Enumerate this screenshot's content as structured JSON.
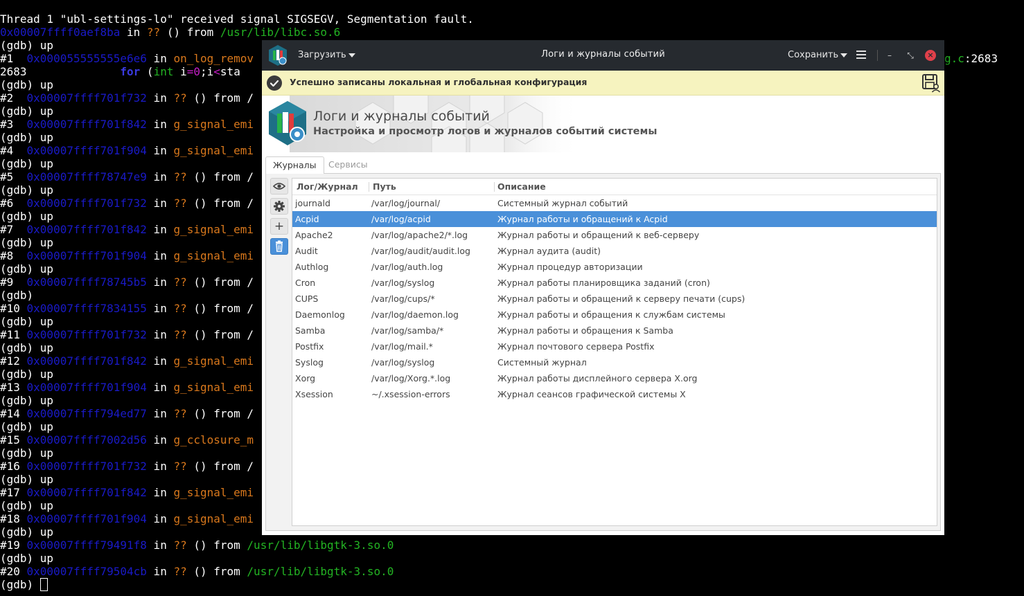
{
  "terminal": {
    "lines": [
      [
        {
          "t": "Thread 1 \"ubl-settings-lo\" received signal SIGSEGV, Segmentation fault."
        }
      ],
      [
        {
          "t": "0x00007ffff0aef8ba",
          "c": "addr"
        },
        {
          "t": " in "
        },
        {
          "t": "??",
          "c": "q"
        },
        {
          "t": " () from "
        },
        {
          "t": "/usr/lib/libc.so.6",
          "c": "path"
        }
      ],
      [
        {
          "t": "(gdb) up"
        }
      ],
      [
        {
          "t": "#1  "
        },
        {
          "t": "0x000055555555e6e6",
          "c": "addr"
        },
        {
          "t": " in "
        },
        {
          "t": "on_log_remov",
          "c": "fn"
        }
      ],
      [
        {
          "t": "2683              "
        },
        {
          "t": "for",
          "c": "kw"
        },
        {
          "t": " ("
        },
        {
          "t": "int",
          "c": "type"
        },
        {
          "t": " i"
        },
        {
          "t": "=",
          "c": "op"
        },
        {
          "t": "0",
          "c": "num"
        },
        {
          "t": ";i"
        },
        {
          "t": "<",
          "c": "op"
        },
        {
          "t": "sta"
        }
      ],
      [
        {
          "t": "(gdb) up"
        }
      ],
      [
        {
          "t": "#2  "
        },
        {
          "t": "0x00007ffff701f732",
          "c": "addr"
        },
        {
          "t": " in "
        },
        {
          "t": "??",
          "c": "q"
        },
        {
          "t": " () from /"
        }
      ],
      [
        {
          "t": "(gdb) up"
        }
      ],
      [
        {
          "t": "#3  "
        },
        {
          "t": "0x00007ffff701f842",
          "c": "addr"
        },
        {
          "t": " in "
        },
        {
          "t": "g_signal_emi",
          "c": "fn"
        }
      ],
      [
        {
          "t": "(gdb) up"
        }
      ],
      [
        {
          "t": "#4  "
        },
        {
          "t": "0x00007ffff701f904",
          "c": "addr"
        },
        {
          "t": " in "
        },
        {
          "t": "g_signal_emi",
          "c": "fn"
        }
      ],
      [
        {
          "t": "(gdb) up"
        }
      ],
      [
        {
          "t": "#5  "
        },
        {
          "t": "0x00007ffff78747e9",
          "c": "addr"
        },
        {
          "t": " in "
        },
        {
          "t": "??",
          "c": "q"
        },
        {
          "t": " () from /"
        }
      ],
      [
        {
          "t": "(gdb) up"
        }
      ],
      [
        {
          "t": "#6  "
        },
        {
          "t": "0x00007ffff701f732",
          "c": "addr"
        },
        {
          "t": " in "
        },
        {
          "t": "??",
          "c": "q"
        },
        {
          "t": " () from /"
        }
      ],
      [
        {
          "t": "(gdb) up"
        }
      ],
      [
        {
          "t": "#7  "
        },
        {
          "t": "0x00007ffff701f842",
          "c": "addr"
        },
        {
          "t": " in "
        },
        {
          "t": "g_signal_emi",
          "c": "fn"
        }
      ],
      [
        {
          "t": "(gdb) up"
        }
      ],
      [
        {
          "t": "#8  "
        },
        {
          "t": "0x00007ffff701f904",
          "c": "addr"
        },
        {
          "t": " in "
        },
        {
          "t": "g_signal_emi",
          "c": "fn"
        }
      ],
      [
        {
          "t": "(gdb) up"
        }
      ],
      [
        {
          "t": "#9  "
        },
        {
          "t": "0x00007ffff78745b5",
          "c": "addr"
        },
        {
          "t": " in "
        },
        {
          "t": "??",
          "c": "q"
        },
        {
          "t": " () from /"
        }
      ],
      [
        {
          "t": "(gdb)"
        }
      ],
      [
        {
          "t": "#10 "
        },
        {
          "t": "0x00007ffff7834155",
          "c": "addr"
        },
        {
          "t": " in "
        },
        {
          "t": "??",
          "c": "q"
        },
        {
          "t": " () from /"
        }
      ],
      [
        {
          "t": "(gdb) up"
        }
      ],
      [
        {
          "t": "#11 "
        },
        {
          "t": "0x00007ffff701f732",
          "c": "addr"
        },
        {
          "t": " in "
        },
        {
          "t": "??",
          "c": "q"
        },
        {
          "t": " () from /"
        }
      ],
      [
        {
          "t": "(gdb) up"
        }
      ],
      [
        {
          "t": "#12 "
        },
        {
          "t": "0x00007ffff701f842",
          "c": "addr"
        },
        {
          "t": " in "
        },
        {
          "t": "g_signal_emi",
          "c": "fn"
        }
      ],
      [
        {
          "t": "(gdb) up"
        }
      ],
      [
        {
          "t": "#13 "
        },
        {
          "t": "0x00007ffff701f904",
          "c": "addr"
        },
        {
          "t": " in "
        },
        {
          "t": "g_signal_emi",
          "c": "fn"
        }
      ],
      [
        {
          "t": "(gdb) up"
        }
      ],
      [
        {
          "t": "#14 "
        },
        {
          "t": "0x00007ffff794ed77",
          "c": "addr"
        },
        {
          "t": " in "
        },
        {
          "t": "??",
          "c": "q"
        },
        {
          "t": " () from /"
        }
      ],
      [
        {
          "t": "(gdb) up"
        }
      ],
      [
        {
          "t": "#15 "
        },
        {
          "t": "0x00007ffff7002d56",
          "c": "addr"
        },
        {
          "t": " in "
        },
        {
          "t": "g_cclosure_m",
          "c": "fn"
        }
      ],
      [
        {
          "t": "(gdb) up"
        }
      ],
      [
        {
          "t": "#16 "
        },
        {
          "t": "0x00007ffff701f732",
          "c": "addr"
        },
        {
          "t": " in "
        },
        {
          "t": "??",
          "c": "q"
        },
        {
          "t": " () from /"
        }
      ],
      [
        {
          "t": "(gdb) up"
        }
      ],
      [
        {
          "t": "#17 "
        },
        {
          "t": "0x00007ffff701f842",
          "c": "addr"
        },
        {
          "t": " in "
        },
        {
          "t": "g_signal_emi",
          "c": "fn"
        }
      ],
      [
        {
          "t": "(gdb) up"
        }
      ],
      [
        {
          "t": "#18 "
        },
        {
          "t": "0x00007ffff701f904",
          "c": "addr"
        },
        {
          "t": " in "
        },
        {
          "t": "g_signal_emi",
          "c": "fn"
        }
      ],
      [
        {
          "t": "(gdb) up"
        }
      ],
      [
        {
          "t": "#19 "
        },
        {
          "t": "0x00007ffff79491f8",
          "c": "addr"
        },
        {
          "t": " in "
        },
        {
          "t": "??",
          "c": "q"
        },
        {
          "t": " () from "
        },
        {
          "t": "/usr/lib/libgtk-3.so.0",
          "c": "path"
        }
      ],
      [
        {
          "t": "(gdb) up"
        }
      ],
      [
        {
          "t": "#20 "
        },
        {
          "t": "0x00007ffff79504cb",
          "c": "addr"
        },
        {
          "t": " in "
        },
        {
          "t": "??",
          "c": "q"
        },
        {
          "t": " () from "
        },
        {
          "t": "/usr/lib/libgtk-3.so.0",
          "c": "path"
        }
      ],
      [
        {
          "t": "(gdb) "
        }
      ]
    ],
    "right_fragment_file": "g.c",
    "right_fragment_line": ":2683",
    "colors": {
      "address": "#1a1ac8",
      "function": "#d9781c",
      "path": "#23b423",
      "keyword": "#3a3ae0"
    }
  },
  "window": {
    "title": "Логи и журналы событий",
    "load_menu": "Загрузить",
    "save_menu": "Сохранить",
    "minimize_glyph": "–",
    "restore_glyph": "⤡",
    "close_glyph": "×"
  },
  "notification": {
    "text": "Успешно записаны локальная и глобальная конфигурация"
  },
  "banner": {
    "title": "Логи и журналы событий",
    "subtitle": "Настройка и просмотр логов и журналов событий системы"
  },
  "tabs": [
    {
      "label": "Журналы",
      "active": true
    },
    {
      "label": "Сервисы",
      "active": false
    }
  ],
  "sidebar_buttons": [
    {
      "name": "view-eye-button",
      "icon": "eye-icon"
    },
    {
      "name": "settings-button",
      "icon": "gear-icon"
    },
    {
      "name": "add-button",
      "icon": "plus-icon",
      "glyph": "+"
    },
    {
      "name": "delete-button",
      "icon": "trash-icon"
    }
  ],
  "table": {
    "columns": [
      "Лог/Журнал",
      "Путь",
      "Описание"
    ],
    "selected_index": 1,
    "rows": [
      [
        "journald",
        "/var/log/journal/",
        "Системный журнал событий"
      ],
      [
        "Acpid",
        "/var/log/acpid",
        "Журнал работы и обращений к Acpid"
      ],
      [
        "Apache2",
        "/var/log/apache2/*.log",
        "Журнал работы и обращений к веб-серверу"
      ],
      [
        "Audit",
        "/var/log/audit/audit.log",
        "Журнал аудита (audit)"
      ],
      [
        "Authlog",
        "/var/log/auth.log",
        "Журнал процедур авторизации"
      ],
      [
        "Cron",
        "/var/log/syslog",
        "Журнал работы планировщика заданий (cron)"
      ],
      [
        "CUPS",
        "/var/log/cups/*",
        "Журнал работы и обращений к серверу печати (cups)"
      ],
      [
        "Daemonlog",
        "/var/log/daemon.log",
        "Журнал работы и обращения к службам системы"
      ],
      [
        "Samba",
        "/var/log/samba/*",
        "Журнал работы и обращения к Samba"
      ],
      [
        "Postfix",
        "/var/log/mail.*",
        "Журнал почтового сервера Postfix"
      ],
      [
        "Syslog",
        "/var/log/syslog",
        "Системный журнал"
      ],
      [
        "Xorg",
        "/var/log/Xorg.*.log",
        "Журнал работы дисплейного сервера X.org"
      ],
      [
        "Xsession",
        "~/.xsession-errors",
        "Журнал сеансов графической системы X"
      ]
    ]
  },
  "colors": {
    "selection": "#4a90d9",
    "titlebar": "#262a2f",
    "notification_bg": "#f6f3bf",
    "close_button": "#e0404a"
  }
}
